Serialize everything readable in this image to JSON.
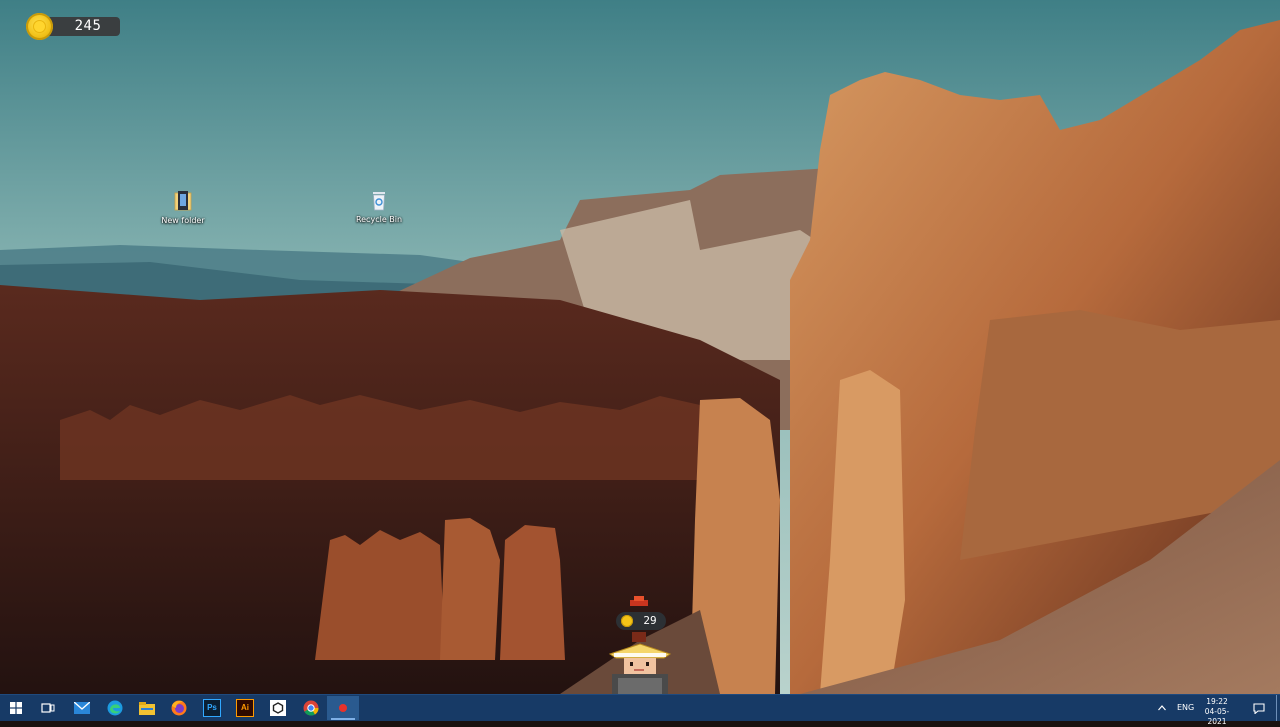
{
  "hud": {
    "coins": "245"
  },
  "desktop": {
    "icons": [
      {
        "label": "New folder",
        "icon": "folder-icon"
      },
      {
        "label": "Recycle Bin",
        "icon": "recycle-bin-icon"
      }
    ]
  },
  "character": {
    "coins": "29"
  },
  "taskbar": {
    "apps": [
      {
        "icon": "start-icon"
      },
      {
        "icon": "task-view-icon"
      },
      {
        "icon": "mail-icon"
      },
      {
        "icon": "edge-icon"
      },
      {
        "icon": "file-explorer-icon"
      },
      {
        "icon": "firefox-icon"
      },
      {
        "icon": "photoshop-icon",
        "text": "Ps"
      },
      {
        "icon": "illustrator-icon",
        "text": "Ai"
      },
      {
        "icon": "unity-icon"
      },
      {
        "icon": "chrome-icon"
      },
      {
        "icon": "game-app-icon"
      }
    ],
    "tray": {
      "language": "ENG",
      "time": "19:22",
      "date": "04-05-2021"
    }
  },
  "colors": {
    "taskbar": "#173a66",
    "coin": "#f2c21a",
    "sky": "#6fa2a6"
  }
}
